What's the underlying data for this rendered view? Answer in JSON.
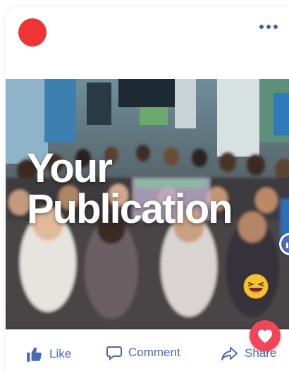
{
  "post": {
    "headline_line1": "Your",
    "headline_line2": "Publication"
  },
  "actions": {
    "like_label": "Like",
    "comment_label": "Comment",
    "share_label": "Share"
  },
  "icons": {
    "avatar": "avatar-circle",
    "more": "ellipsis-icon",
    "like": "thumbs-up-icon",
    "comment": "speech-bubble-icon",
    "share": "share-arrow-icon",
    "reaction_like": "thumbs-up-icon",
    "reaction_laugh": "laughing-emoji-icon",
    "reaction_love": "heart-icon"
  },
  "colors": {
    "avatar": "#f03434",
    "accent": "#3d5fae",
    "action_text": "#4a6cb5",
    "love": "#f0465a",
    "laugh": "#f6c22d"
  }
}
